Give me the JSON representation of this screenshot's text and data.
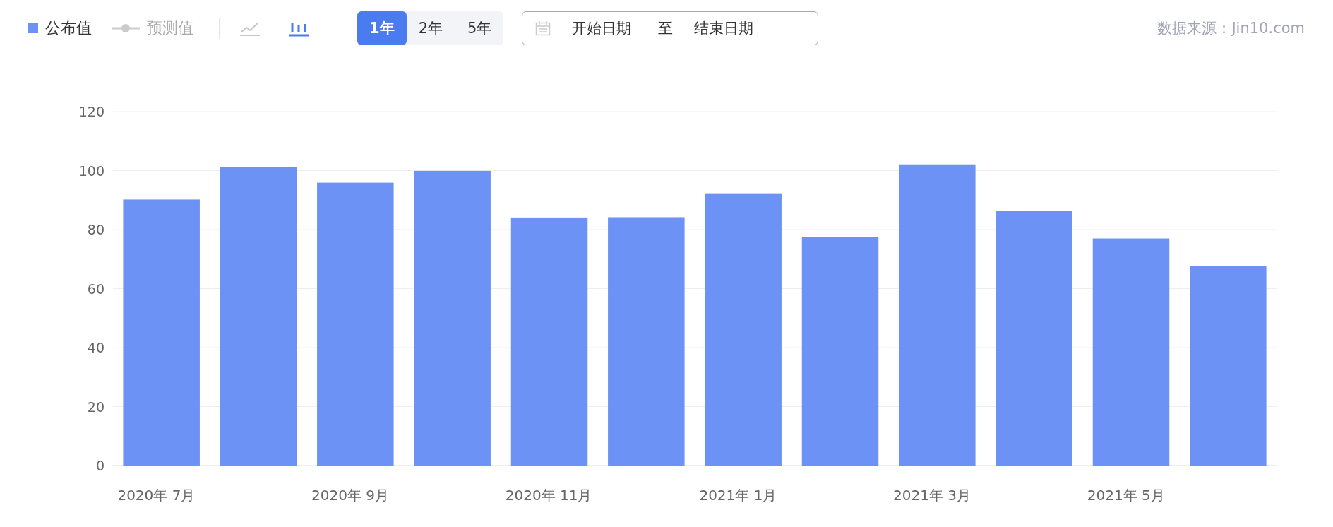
{
  "legend": [
    {
      "kind": "square",
      "label": "公布值",
      "enabled": true
    },
    {
      "kind": "line-dot",
      "label": "预测值",
      "enabled": false
    }
  ],
  "chart_types": [
    {
      "kind": "line",
      "selected": false
    },
    {
      "kind": "bar",
      "selected": true
    }
  ],
  "ranges": [
    {
      "label": "1年",
      "selected": true
    },
    {
      "label": "2年",
      "selected": false
    },
    {
      "label": "5年",
      "selected": false
    }
  ],
  "date_range": {
    "start_placeholder": "开始日期",
    "separator": "至",
    "end_placeholder": "结束日期"
  },
  "source": "数据来源：Jin10.com",
  "chart_data": {
    "type": "bar",
    "categories": [
      "2020年 7月",
      null,
      "2020年 9月",
      null,
      "2020年 11月",
      null,
      "2021年 1月",
      null,
      "2021年 3月",
      null,
      "2021年 5月",
      null
    ],
    "series": [
      {
        "color": "#6b92f4",
        "values": [
          90.2,
          101.1,
          95.9,
          99.9,
          84.1,
          84.2,
          92.3,
          77.6,
          102.1,
          86.3,
          77.0,
          67.6
        ]
      }
    ],
    "ylim": [
      0,
      120
    ],
    "yticks": [
      0,
      20,
      40,
      60,
      80,
      100,
      120
    ],
    "grid": true
  }
}
